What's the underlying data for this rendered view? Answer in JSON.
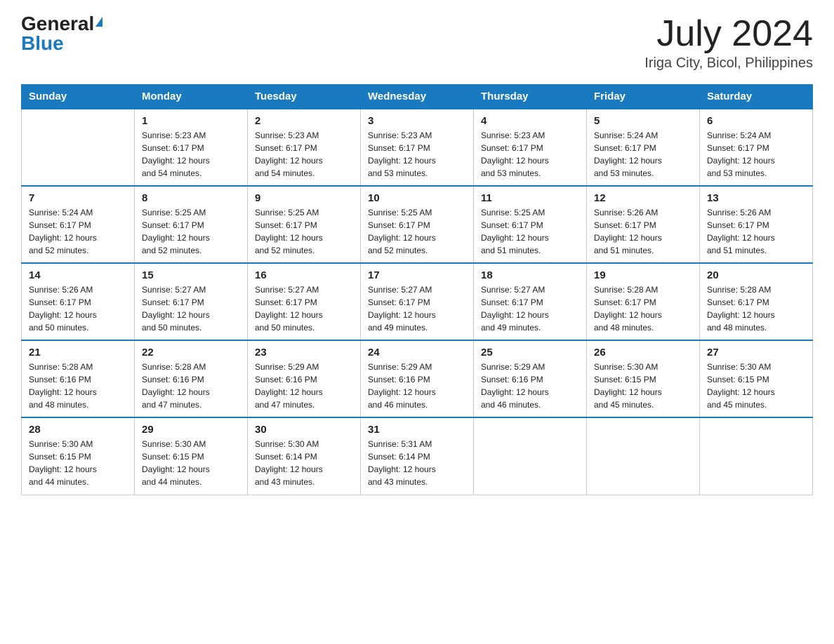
{
  "header": {
    "logo_general": "General",
    "logo_blue": "Blue",
    "month_title": "July 2024",
    "location": "Iriga City, Bicol, Philippines"
  },
  "days_of_week": [
    "Sunday",
    "Monday",
    "Tuesday",
    "Wednesday",
    "Thursday",
    "Friday",
    "Saturday"
  ],
  "weeks": [
    [
      {
        "day": "",
        "info": ""
      },
      {
        "day": "1",
        "info": "Sunrise: 5:23 AM\nSunset: 6:17 PM\nDaylight: 12 hours\nand 54 minutes."
      },
      {
        "day": "2",
        "info": "Sunrise: 5:23 AM\nSunset: 6:17 PM\nDaylight: 12 hours\nand 54 minutes."
      },
      {
        "day": "3",
        "info": "Sunrise: 5:23 AM\nSunset: 6:17 PM\nDaylight: 12 hours\nand 53 minutes."
      },
      {
        "day": "4",
        "info": "Sunrise: 5:23 AM\nSunset: 6:17 PM\nDaylight: 12 hours\nand 53 minutes."
      },
      {
        "day": "5",
        "info": "Sunrise: 5:24 AM\nSunset: 6:17 PM\nDaylight: 12 hours\nand 53 minutes."
      },
      {
        "day": "6",
        "info": "Sunrise: 5:24 AM\nSunset: 6:17 PM\nDaylight: 12 hours\nand 53 minutes."
      }
    ],
    [
      {
        "day": "7",
        "info": "Sunrise: 5:24 AM\nSunset: 6:17 PM\nDaylight: 12 hours\nand 52 minutes."
      },
      {
        "day": "8",
        "info": "Sunrise: 5:25 AM\nSunset: 6:17 PM\nDaylight: 12 hours\nand 52 minutes."
      },
      {
        "day": "9",
        "info": "Sunrise: 5:25 AM\nSunset: 6:17 PM\nDaylight: 12 hours\nand 52 minutes."
      },
      {
        "day": "10",
        "info": "Sunrise: 5:25 AM\nSunset: 6:17 PM\nDaylight: 12 hours\nand 52 minutes."
      },
      {
        "day": "11",
        "info": "Sunrise: 5:25 AM\nSunset: 6:17 PM\nDaylight: 12 hours\nand 51 minutes."
      },
      {
        "day": "12",
        "info": "Sunrise: 5:26 AM\nSunset: 6:17 PM\nDaylight: 12 hours\nand 51 minutes."
      },
      {
        "day": "13",
        "info": "Sunrise: 5:26 AM\nSunset: 6:17 PM\nDaylight: 12 hours\nand 51 minutes."
      }
    ],
    [
      {
        "day": "14",
        "info": "Sunrise: 5:26 AM\nSunset: 6:17 PM\nDaylight: 12 hours\nand 50 minutes."
      },
      {
        "day": "15",
        "info": "Sunrise: 5:27 AM\nSunset: 6:17 PM\nDaylight: 12 hours\nand 50 minutes."
      },
      {
        "day": "16",
        "info": "Sunrise: 5:27 AM\nSunset: 6:17 PM\nDaylight: 12 hours\nand 50 minutes."
      },
      {
        "day": "17",
        "info": "Sunrise: 5:27 AM\nSunset: 6:17 PM\nDaylight: 12 hours\nand 49 minutes."
      },
      {
        "day": "18",
        "info": "Sunrise: 5:27 AM\nSunset: 6:17 PM\nDaylight: 12 hours\nand 49 minutes."
      },
      {
        "day": "19",
        "info": "Sunrise: 5:28 AM\nSunset: 6:17 PM\nDaylight: 12 hours\nand 48 minutes."
      },
      {
        "day": "20",
        "info": "Sunrise: 5:28 AM\nSunset: 6:17 PM\nDaylight: 12 hours\nand 48 minutes."
      }
    ],
    [
      {
        "day": "21",
        "info": "Sunrise: 5:28 AM\nSunset: 6:16 PM\nDaylight: 12 hours\nand 48 minutes."
      },
      {
        "day": "22",
        "info": "Sunrise: 5:28 AM\nSunset: 6:16 PM\nDaylight: 12 hours\nand 47 minutes."
      },
      {
        "day": "23",
        "info": "Sunrise: 5:29 AM\nSunset: 6:16 PM\nDaylight: 12 hours\nand 47 minutes."
      },
      {
        "day": "24",
        "info": "Sunrise: 5:29 AM\nSunset: 6:16 PM\nDaylight: 12 hours\nand 46 minutes."
      },
      {
        "day": "25",
        "info": "Sunrise: 5:29 AM\nSunset: 6:16 PM\nDaylight: 12 hours\nand 46 minutes."
      },
      {
        "day": "26",
        "info": "Sunrise: 5:30 AM\nSunset: 6:15 PM\nDaylight: 12 hours\nand 45 minutes."
      },
      {
        "day": "27",
        "info": "Sunrise: 5:30 AM\nSunset: 6:15 PM\nDaylight: 12 hours\nand 45 minutes."
      }
    ],
    [
      {
        "day": "28",
        "info": "Sunrise: 5:30 AM\nSunset: 6:15 PM\nDaylight: 12 hours\nand 44 minutes."
      },
      {
        "day": "29",
        "info": "Sunrise: 5:30 AM\nSunset: 6:15 PM\nDaylight: 12 hours\nand 44 minutes."
      },
      {
        "day": "30",
        "info": "Sunrise: 5:30 AM\nSunset: 6:14 PM\nDaylight: 12 hours\nand 43 minutes."
      },
      {
        "day": "31",
        "info": "Sunrise: 5:31 AM\nSunset: 6:14 PM\nDaylight: 12 hours\nand 43 minutes."
      },
      {
        "day": "",
        "info": ""
      },
      {
        "day": "",
        "info": ""
      },
      {
        "day": "",
        "info": ""
      }
    ]
  ]
}
